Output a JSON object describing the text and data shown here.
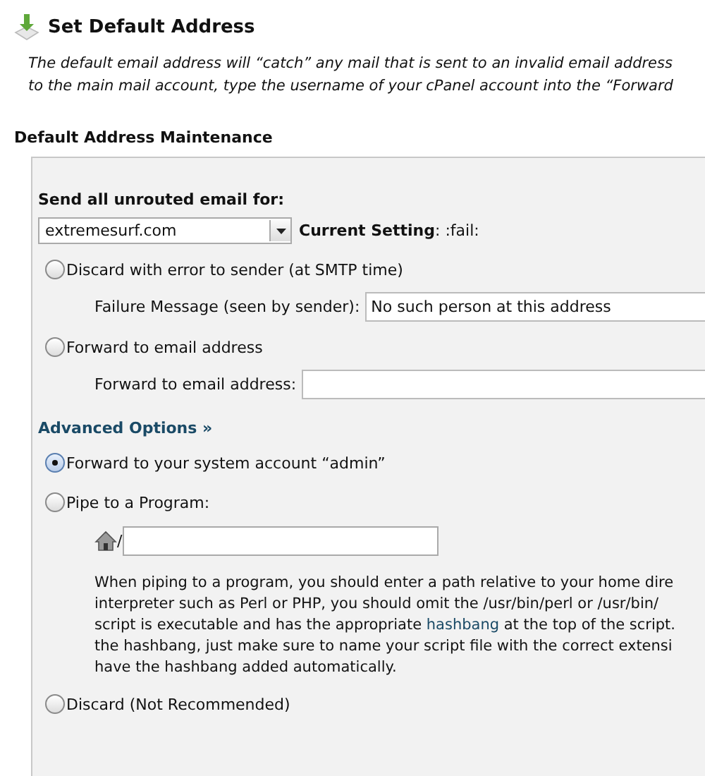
{
  "header": {
    "title": "Set Default Address"
  },
  "intro_lines": [
    "The default email address will “catch” any mail that is sent to an invalid email address",
    "to the main mail account, type the username of your cPanel account into the “Forward"
  ],
  "section_title": "Default Address Maintenance",
  "panel": {
    "domain_label": "Send all unrouted email for:",
    "domain_select": {
      "value": "extremesurf.com"
    },
    "current_setting": "**Current Setting**: :fail:",
    "basic_options": [
      {
        "kind": "field",
        "label": "Discard with error to sender (at SMTP time)",
        "selected": false,
        "field": {
          "label": "Failure Message (seen by sender):",
          "value": "No such person at this address"
        }
      },
      {
        "kind": "field",
        "label": "Forward to email address",
        "selected": false,
        "field": {
          "label": "Forward to email address:"
        }
      }
    ],
    "advanced_link": "Advanced Options »",
    "advanced_options": [
      {
        "kind": "plain",
        "label": "Forward to your system account “admin”",
        "selected": true
      },
      {
        "kind": "pipe",
        "label": "Pipe to a Program:",
        "selected": false,
        "path_prefix": "/",
        "help_lines": [
          [
            {
              "text": "When piping to a program, you should enter a path relative to your home dire"
            }
          ],
          [
            {
              "text": "interpreter such as Perl or PHP, you should omit the /usr/bin/perl or /usr/bin/"
            }
          ],
          [
            {
              "text": "script is executable and has the appropriate "
            },
            {
              "text": "hashbang",
              "kind": "link"
            },
            {
              "text": " at the top of the script."
            }
          ],
          [
            {
              "text": "the hashbang, just make sure to name your script file with the correct extensi"
            }
          ],
          [
            {
              "text": "have the hashbang added automatically."
            }
          ]
        ]
      },
      {
        "kind": "plain",
        "label": "Discard (Not Recommended)",
        "selected": false
      }
    ]
  }
}
